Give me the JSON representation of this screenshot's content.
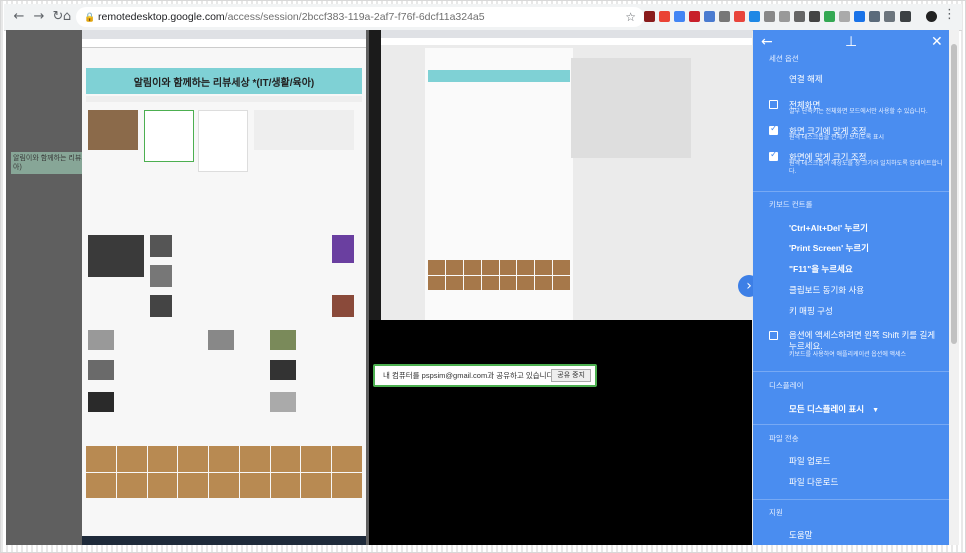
{
  "browser": {
    "url_host": "remotedesktop.google.com",
    "url_path": "/access/session/2bccf383-119a-2af7-f76f-6dcf11a324a5"
  },
  "remote": {
    "blog_title": "알림이와 함께하는 리뷰세상 *(IT/생활/육아)",
    "ghost_label": "알림이와 함께하는 리뷰세상 *(IT/생활/육아)",
    "share_message": "내 컴퓨터를 pspsim@gmail.com과 공유하고 있습니다.",
    "share_stop": "공유 중지"
  },
  "panel": {
    "session_options_header": "세션 옵션",
    "disconnect": "연결 해제",
    "fullscreen": {
      "label": "전체화면",
      "desc": "일부 단축키는 전체화면 모드에서만 사용할 수 있습니다.",
      "checked": false
    },
    "fit_to_window": {
      "label": "화면 크기에 맞게 조정",
      "desc": "원격 데스크톱을 전체가 보이도록 표시",
      "checked": true
    },
    "resize_to_fit": {
      "label": "화면에 맞게 크기 조정",
      "desc": "원격 데스크톱의 해상도를 창 크기와 일치하도록 업데이트합니다.",
      "checked": true
    },
    "keyboard_header": "키보드 컨트롤",
    "ctrl_alt_del": "'Ctrl+Alt+Del' 누르기",
    "print_screen": "'Print Screen' 누르기",
    "f11": "\"F11\"을 누르세요",
    "clipboard_sync": "클립보드 동기화 사용",
    "keymap": "키 매핑 구성",
    "shift_option": {
      "label": "옵션에 액세스하려면 왼쪽 Shift 키를 길게 누르세요.",
      "desc": "키보드를 사용하여 애플리케이션 옵션에 액세스",
      "checked": false
    },
    "display_header": "디스플레이",
    "display_select": "모든 디스플레이 표시",
    "file_transfer_header": "파일 전송",
    "upload_file": "파일 업로드",
    "download_file": "파일 다운로드",
    "support_header": "지원",
    "help": "도움말"
  },
  "colors": {
    "panel_bg": "#4a8df0",
    "share_border": "#4caf50"
  }
}
